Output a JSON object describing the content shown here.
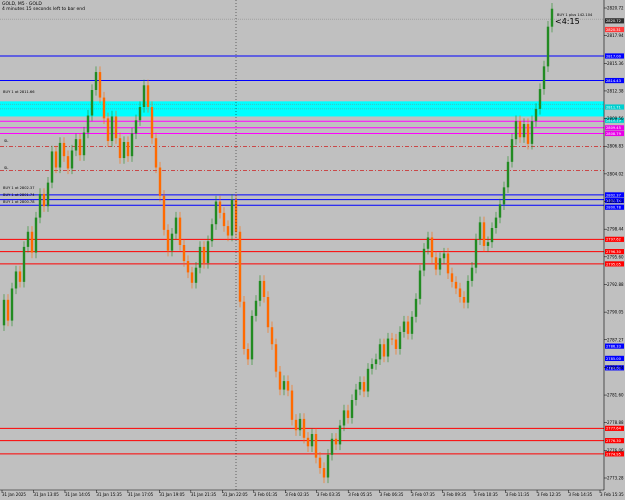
{
  "header": {
    "symbol_line": "GOLD, M5 · GOLD",
    "timer_line": "4 minutes 15 seconds left to bar end"
  },
  "countdown": "<4:15",
  "colors": {
    "background": "#c0c0c0",
    "bull": "#228b22",
    "bear": "#ff6a00",
    "resistance": "#0000ff",
    "support": "#ff0000",
    "cyan_zone": "#00ffff",
    "magenta": "#ff00ff"
  },
  "price_axis": {
    "ticks": [
      "2820.72",
      "2817.94",
      "2815.36",
      "2812.38",
      "2809.56",
      "2806.83",
      "2804.02",
      "2801.22",
      "2798.44",
      "2795.60",
      "2792.88",
      "2790.05",
      "2787.27",
      "2784.44",
      "2781.60",
      "2778.88",
      "2776.06",
      "2773.28"
    ]
  },
  "time_axis": {
    "ticks": [
      "31 Jan 2025",
      "31 Jan 13:05",
      "31 Jan 14:05",
      "31 Jan 15:35",
      "31 Jan 17:05",
      "31 Jan 19:05",
      "31 Jan 21:35",
      "31 Jan 22:05",
      "3 Feb 01:35",
      "3 Feb 02:35",
      "3 Feb 03:35",
      "3 Feb 05:35",
      "3 Feb 06:35",
      "3 Feb 07:35",
      "3 Feb 09:35",
      "3 Feb 10:35",
      "3 Feb 11:35",
      "3 Feb 12:35",
      "3 Feb 14:35",
      "3 Feb 15:35"
    ]
  },
  "level_labels": {
    "buy_limit": "BUY 1 at 2811.66",
    "buy1": "BUY 1 at 2802.37",
    "buy2": "BUY 1 at 2801.74",
    "buy3": "BUY 1 at 2800.78",
    "sl1": "SL",
    "sl2": "SL",
    "top_right": "BUY 1 plus 142.104"
  },
  "chart_data": {
    "type": "candlestick",
    "symbol": "GOLD",
    "timeframe": "M5",
    "ylim": [
      2771.5,
      2822.5
    ],
    "points": [
      [
        4,
        2788.5,
        2791.2
      ],
      [
        8,
        2791.2,
        2789.0
      ],
      [
        12,
        2789.0,
        2792.4
      ],
      [
        16,
        2792.4,
        2794.2
      ],
      [
        20,
        2794.2,
        2793.1
      ],
      [
        24,
        2793.1,
        2796.8
      ],
      [
        28,
        2796.8,
        2798.4
      ],
      [
        32,
        2798.4,
        2796.2
      ],
      [
        36,
        2796.2,
        2799.9
      ],
      [
        40,
        2799.9,
        2802.4
      ],
      [
        44,
        2802.4,
        2801.1
      ],
      [
        48,
        2801.1,
        2803.6
      ],
      [
        52,
        2803.6,
        2806.9
      ],
      [
        56,
        2806.9,
        2805.2
      ],
      [
        60,
        2805.2,
        2807.8
      ],
      [
        64,
        2807.8,
        2806.4
      ],
      [
        68,
        2806.4,
        2805.1
      ],
      [
        72,
        2805.1,
        2807.0
      ],
      [
        76,
        2807.0,
        2808.2
      ],
      [
        80,
        2808.2,
        2806.5
      ],
      [
        84,
        2806.5,
        2808.9
      ],
      [
        88,
        2808.9,
        2810.7
      ],
      [
        92,
        2810.7,
        2813.4
      ],
      [
        96,
        2813.4,
        2815.3
      ],
      [
        100,
        2815.3,
        2812.6
      ],
      [
        104,
        2812.6,
        2810.4
      ],
      [
        108,
        2810.4,
        2808.0
      ],
      [
        112,
        2808.0,
        2810.6
      ],
      [
        116,
        2810.6,
        2808.3
      ],
      [
        120,
        2808.3,
        2806.2
      ],
      [
        124,
        2806.2,
        2807.9
      ],
      [
        128,
        2807.9,
        2806.4
      ],
      [
        132,
        2806.4,
        2808.8
      ],
      [
        136,
        2808.8,
        2810.2
      ],
      [
        140,
        2810.2,
        2811.6
      ],
      [
        144,
        2811.6,
        2813.9
      ],
      [
        148,
        2813.9,
        2811.6
      ],
      [
        152,
        2811.6,
        2808.3
      ],
      [
        156,
        2808.3,
        2805.2
      ],
      [
        160,
        2805.2,
        2802.2
      ],
      [
        164,
        2802.2,
        2798.6
      ],
      [
        168,
        2798.6,
        2796.4
      ],
      [
        172,
        2796.4,
        2798.2
      ],
      [
        176,
        2798.2,
        2799.9
      ],
      [
        180,
        2799.9,
        2797.0
      ],
      [
        184,
        2797.0,
        2795.3
      ],
      [
        188,
        2795.3,
        2794.1
      ],
      [
        192,
        2794.1,
        2793.0
      ],
      [
        196,
        2793.0,
        2794.6
      ],
      [
        200,
        2794.6,
        2796.8
      ],
      [
        204,
        2796.8,
        2795.1
      ],
      [
        208,
        2795.1,
        2797.4
      ],
      [
        212,
        2797.4,
        2799.2
      ],
      [
        216,
        2799.2,
        2801.6
      ],
      [
        220,
        2801.6,
        2800.4
      ],
      [
        224,
        2800.4,
        2799.0
      ],
      [
        228,
        2799.0,
        2798.0
      ],
      [
        232,
        2798.0,
        2801.8
      ],
      [
        236,
        2801.8,
        2798.4
      ],
      [
        240,
        2798.4,
        2791.0
      ],
      [
        244,
        2791.0,
        2786.0
      ],
      [
        248,
        2786.0,
        2784.9
      ],
      [
        252,
        2784.9,
        2789.5
      ],
      [
        256,
        2789.5,
        2791.1
      ],
      [
        260,
        2791.1,
        2793.2
      ],
      [
        264,
        2793.2,
        2791.5
      ],
      [
        268,
        2791.5,
        2788.3
      ],
      [
        272,
        2788.3,
        2786.5
      ],
      [
        276,
        2786.5,
        2783.6
      ],
      [
        280,
        2783.6,
        2781.7
      ],
      [
        284,
        2781.7,
        2782.6
      ],
      [
        288,
        2782.6,
        2781.6
      ],
      [
        292,
        2781.6,
        2778.5
      ],
      [
        296,
        2778.5,
        2777.4
      ],
      [
        300,
        2777.4,
        2778.6
      ],
      [
        304,
        2778.6,
        2776.6
      ],
      [
        308,
        2776.6,
        2775.7
      ],
      [
        312,
        2775.7,
        2777.0
      ],
      [
        316,
        2777.0,
        2774.5
      ],
      [
        320,
        2774.5,
        2773.4
      ],
      [
        324,
        2773.4,
        2772.4
      ],
      [
        328,
        2772.4,
        2774.8
      ],
      [
        332,
        2774.8,
        2776.5
      ],
      [
        336,
        2776.5,
        2775.9
      ],
      [
        340,
        2775.9,
        2777.9
      ],
      [
        344,
        2777.9,
        2779.5
      ],
      [
        348,
        2779.5,
        2778.7
      ],
      [
        352,
        2778.7,
        2780.6
      ],
      [
        356,
        2780.6,
        2781.7
      ],
      [
        360,
        2781.7,
        2782.5
      ],
      [
        364,
        2782.5,
        2781.5
      ],
      [
        368,
        2781.5,
        2783.9
      ],
      [
        372,
        2783.9,
        2784.4
      ],
      [
        376,
        2784.4,
        2784.9
      ],
      [
        380,
        2784.9,
        2786.5
      ],
      [
        384,
        2786.5,
        2785.2
      ],
      [
        388,
        2785.2,
        2787.1
      ],
      [
        392,
        2787.1,
        2787.0
      ],
      [
        396,
        2787.0,
        2786.0
      ],
      [
        400,
        2786.0,
        2787.8
      ],
      [
        404,
        2787.8,
        2788.9
      ],
      [
        408,
        2788.9,
        2787.6
      ],
      [
        412,
        2787.6,
        2789.4
      ],
      [
        416,
        2789.4,
        2791.3
      ],
      [
        420,
        2791.3,
        2794.3
      ],
      [
        424,
        2794.3,
        2796.6
      ],
      [
        428,
        2796.6,
        2797.8
      ],
      [
        432,
        2797.8,
        2795.7
      ],
      [
        436,
        2795.7,
        2794.4
      ],
      [
        440,
        2794.4,
        2795.6
      ],
      [
        444,
        2795.6,
        2796.1
      ],
      [
        448,
        2796.1,
        2794.0
      ],
      [
        452,
        2794.0,
        2793.1
      ],
      [
        456,
        2793.1,
        2792.4
      ],
      [
        460,
        2792.4,
        2791.5
      ],
      [
        464,
        2791.5,
        2790.9
      ],
      [
        468,
        2790.9,
        2793.2
      ],
      [
        472,
        2793.2,
        2794.6
      ],
      [
        476,
        2794.6,
        2797.6
      ],
      [
        480,
        2797.6,
        2799.4
      ],
      [
        484,
        2799.4,
        2796.9
      ],
      [
        488,
        2796.9,
        2797.3
      ],
      [
        492,
        2797.3,
        2798.8
      ],
      [
        496,
        2798.8,
        2799.9
      ],
      [
        500,
        2799.9,
        2801.3
      ],
      [
        504,
        2801.3,
        2803.1
      ],
      [
        508,
        2803.1,
        2805.8
      ],
      [
        512,
        2805.8,
        2808.2
      ],
      [
        516,
        2808.2,
        2810.1
      ],
      [
        520,
        2810.1,
        2808.4
      ],
      [
        524,
        2808.4,
        2809.8
      ],
      [
        528,
        2809.8,
        2807.7
      ],
      [
        532,
        2807.7,
        2810.1
      ],
      [
        536,
        2810.1,
        2811.4
      ],
      [
        540,
        2811.4,
        2813.5
      ],
      [
        544,
        2813.5,
        2815.9
      ],
      [
        548,
        2815.9,
        2820.1
      ],
      [
        552,
        2820.1,
        2822.0
      ]
    ],
    "resistance_levels": [
      2817.0,
      2814.4,
      2802.3,
      2801.8,
      2801.2
    ],
    "support_levels": [
      2797.6,
      2796.3,
      2795.0,
      2777.6,
      2776.3,
      2774.9
    ],
    "zones": {
      "cyan": [
        2810.6,
        2812.2
      ],
      "magenta_lines": [
        2810.1,
        2809.4,
        2808.8
      ]
    },
    "stop_lines": [
      2807.4,
      2804.9
    ],
    "tags": [
      {
        "y": 2820.72,
        "label": "2820.72",
        "color": "#2f2f2f"
      },
      {
        "y": 2819.8,
        "label": "2820.31",
        "color": "#ff3b3b"
      },
      {
        "y": 2817.0,
        "label": "2817.00",
        "color": "#0000ff"
      },
      {
        "y": 2814.4,
        "label": "2814.43",
        "color": "#0000ff"
      },
      {
        "y": 2811.6,
        "label": "2811.71",
        "color": "#00cfcf"
      },
      {
        "y": 2810.2,
        "label": "2810.19",
        "color": "#00cfcf"
      },
      {
        "y": 2809.4,
        "label": "2809.45",
        "color": "#e800e8"
      },
      {
        "y": 2808.8,
        "label": "2808.79",
        "color": "#e800e8"
      },
      {
        "y": 2802.3,
        "label": "2802.37",
        "color": "#0000ff"
      },
      {
        "y": 2801.7,
        "label": "2801.74",
        "color": "#0000ff"
      },
      {
        "y": 2801.0,
        "label": "2800.78",
        "color": "#0000ff"
      },
      {
        "y": 2797.6,
        "label": "2797.62",
        "color": "#ff0000"
      },
      {
        "y": 2796.3,
        "label": "2796.30",
        "color": "#ff0000"
      },
      {
        "y": 2795.0,
        "label": "2795.05",
        "color": "#ff0000"
      },
      {
        "y": 2786.3,
        "label": "2786.33",
        "color": "#0000ff"
      },
      {
        "y": 2785.0,
        "label": "2785.00",
        "color": "#0000ff"
      },
      {
        "y": 2784.0,
        "label": "2784.00",
        "color": "#0000ff"
      },
      {
        "y": 2777.6,
        "label": "2777.64",
        "color": "#ff0000"
      },
      {
        "y": 2776.3,
        "label": "2776.30",
        "color": "#ff0000"
      },
      {
        "y": 2774.9,
        "label": "2774.95",
        "color": "#ff0000"
      }
    ]
  }
}
